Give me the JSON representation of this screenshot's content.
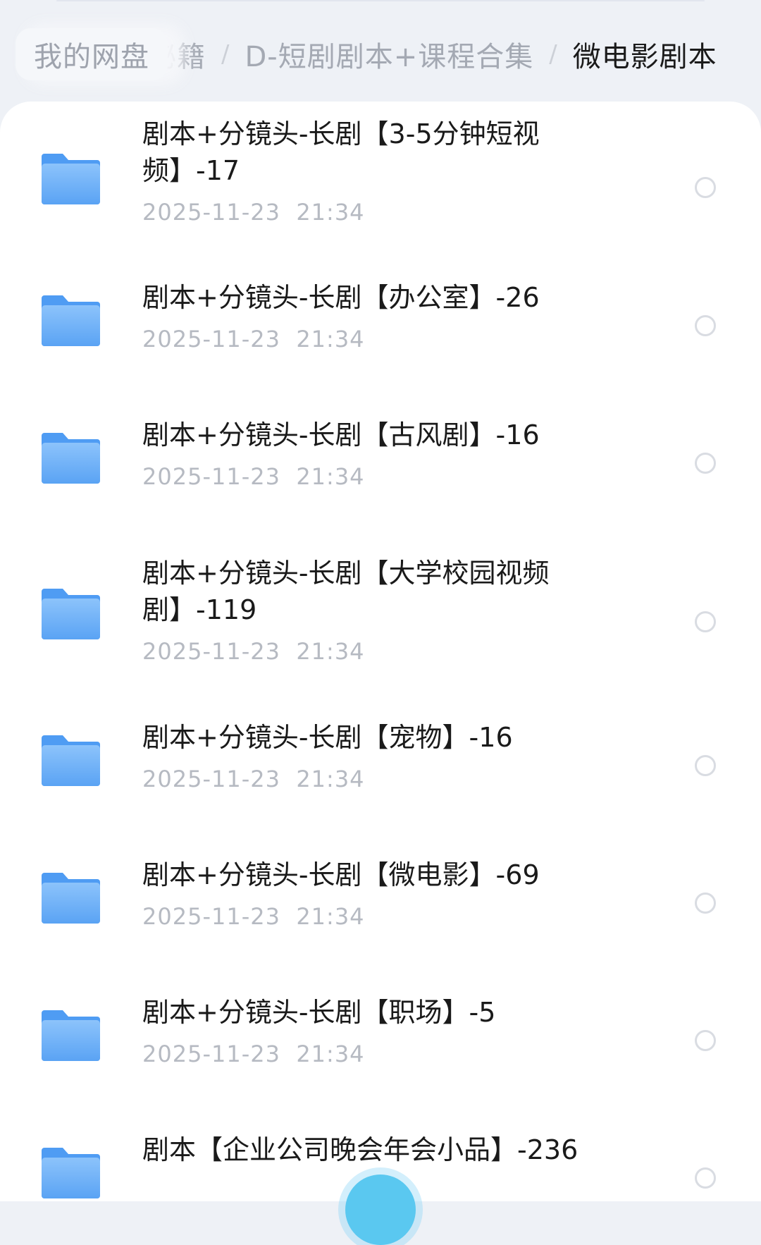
{
  "breadcrumb": {
    "root": "我的网盘",
    "items": [
      "秘籍",
      "D-短剧剧本+课程合集",
      "微电影剧本"
    ],
    "separator": "/"
  },
  "files": [
    {
      "name": "剧本+分镜头-长剧【3-5分钟短视频】-17",
      "date": "2025-11-23  21:34"
    },
    {
      "name": "剧本+分镜头-长剧【办公室】-26",
      "date": "2025-11-23  21:34"
    },
    {
      "name": "剧本+分镜头-长剧【古风剧】-16",
      "date": "2025-11-23  21:34"
    },
    {
      "name": "剧本+分镜头-长剧【大学校园视频剧】-119",
      "date": "2025-11-23  21:34"
    },
    {
      "name": "剧本+分镜头-长剧【宠物】-16",
      "date": "2025-11-23  21:34"
    },
    {
      "name": "剧本+分镜头-长剧【微电影】-69",
      "date": "2025-11-23  21:34"
    },
    {
      "name": "剧本+分镜头-长剧【职场】-5",
      "date": "2025-11-23  21:34"
    },
    {
      "name": "剧本【企业公司晚会年会小品】-236",
      "date": ""
    }
  ],
  "icons": {
    "folder": "folder-icon",
    "select": "radio-unchecked-icon"
  },
  "colors": {
    "folder_light": "#8cc3fb",
    "folder_dark": "#4f9cf3",
    "accent": "#5ac8f0"
  }
}
